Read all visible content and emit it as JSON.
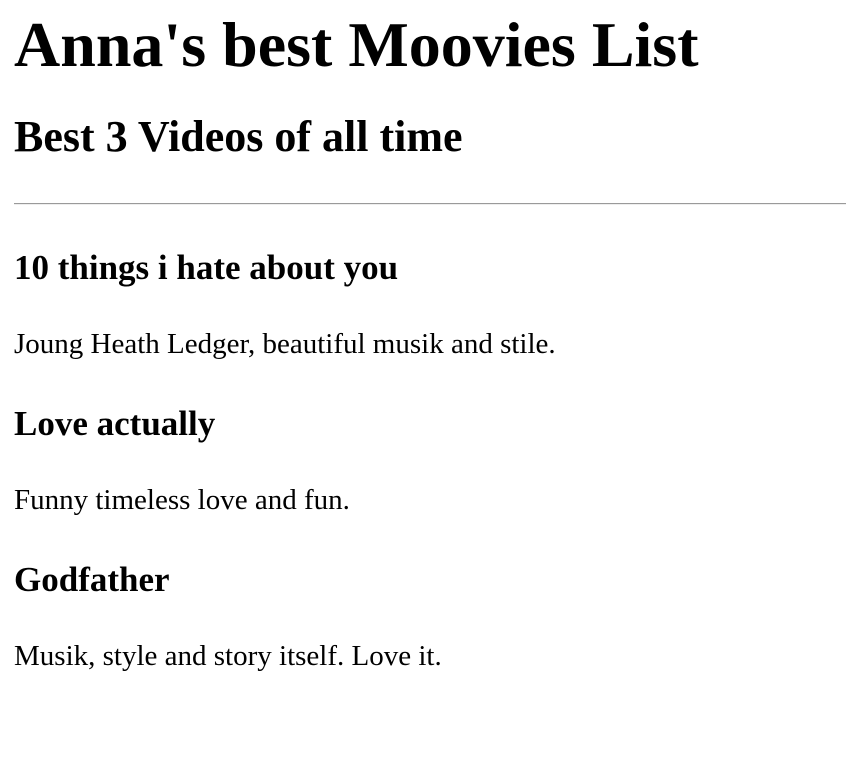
{
  "page": {
    "title": "Anna's best Moovies List",
    "subtitle": "Best 3 Videos of all time"
  },
  "movies": [
    {
      "title": "10 things i hate about you",
      "description": "Joung Heath Ledger, beautiful musik and stile."
    },
    {
      "title": "Love actually",
      "description": "Funny timeless love and fun."
    },
    {
      "title": "Godfather",
      "description": "Musik, style and story itself. Love it."
    }
  ]
}
